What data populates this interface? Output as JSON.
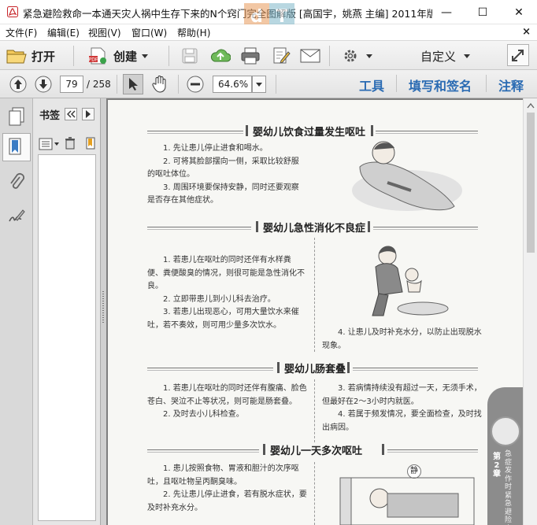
{
  "window": {
    "title": "紧急避险救命一本通天灾人祸中生存下来的N个窍门完全图解版 [高国宇，姚燕 主编] 2011年版...",
    "watermark_text": "",
    "controls": {
      "minimize": "—",
      "maximize": "☐",
      "close": "✕"
    }
  },
  "menu": {
    "items": [
      "文件(F)",
      "编辑(E)",
      "视图(V)",
      "窗口(W)",
      "帮助(H)"
    ],
    "close_doc": "×"
  },
  "toolbar": {
    "open_label": "打开",
    "create_label": "创建",
    "customize_label": "自定义",
    "icons": [
      "open-folder-icon",
      "create-pdf-icon",
      "save-icon",
      "upload-icon",
      "print-icon",
      "edit-icon",
      "email-icon",
      "gear-icon",
      "fullscreen-icon"
    ]
  },
  "navbar": {
    "current_page": "79",
    "total_pages": "/ 258",
    "zoom": "64.6%",
    "links": [
      "工具",
      "填写和签名",
      "注释"
    ]
  },
  "sidebar": {
    "bookmarks_label": "书签"
  },
  "document": {
    "sections": [
      {
        "title": "婴幼儿饮食过量发生呕吐",
        "items": [
          "1. 先让患儿停止进食和喝水。",
          "2. 可将其脸部摆向一侧，采取比较舒服的呕吐体位。",
          "3. 周围环境要保持安静，同时还要观察是否存在其他症状。"
        ]
      },
      {
        "title": "婴幼儿急性消化不良症",
        "items": [
          "1. 若患儿在呕吐的同时还伴有水样粪便、粪便酸臭的情况，则很可能是急性消化不良。",
          "2. 立即带患儿到小儿科去治疗。",
          "3. 若患儿出现恶心，可用大量饮水来催吐，若不奏效，则可用少量多次饮水。"
        ],
        "item4": "4. 让患儿及时补充水分，以防止出现脱水现象。"
      },
      {
        "title": "婴幼儿肠套叠",
        "left_items": [
          "1. 若患儿在呕吐的同时还伴有腹痛、脸色苍白、哭泣不止等状况，则可能是肠套叠。",
          "2. 及时去小儿科检查。"
        ],
        "right_items": [
          "3. 若病情持续没有超过一天，无须手术，但最好在2～3小时内就医。",
          "4. 若属于频发情况，要全面检查，及时找出病因。"
        ]
      },
      {
        "title": "婴幼儿一天多次呕吐",
        "items": [
          "1. 患儿按照食物、胃液和胆汁的次序呕吐，且呕吐物呈丙酮臭味。",
          "2. 先让患儿停止进食，若有脱水症状，要及时补充水分。"
        ]
      }
    ],
    "chapter_tab": {
      "number": "第2章",
      "subtitle": "急症发作时紧急避险方"
    },
    "badge": "静"
  }
}
